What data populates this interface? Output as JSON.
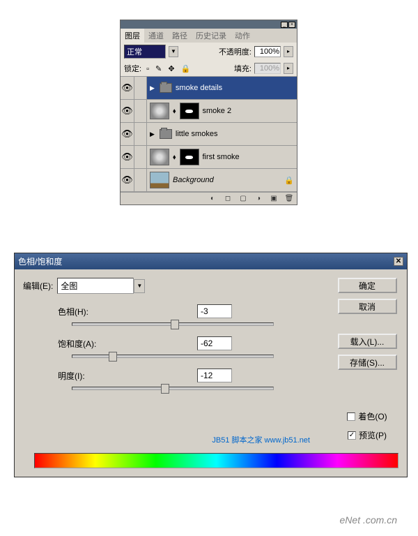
{
  "layers_panel": {
    "tabs": [
      "图层",
      "通道",
      "路径",
      "历史记录",
      "动作"
    ],
    "active_tab": 0,
    "blend_mode": "正常",
    "opacity_label": "不透明度:",
    "opacity_value": "100%",
    "lock_label": "锁定:",
    "fill_label": "填充:",
    "fill_value": "100%",
    "layers": [
      {
        "name": "smoke details",
        "type": "folder",
        "visible": true,
        "selected": true
      },
      {
        "name": "smoke 2",
        "type": "layer_mask",
        "visible": true
      },
      {
        "name": "little smokes",
        "type": "folder",
        "visible": true
      },
      {
        "name": "first smoke",
        "type": "layer_mask",
        "visible": true
      },
      {
        "name": "Background",
        "type": "background",
        "visible": true
      }
    ]
  },
  "dialog": {
    "title": "色相/饱和度",
    "edit_label": "编辑(E):",
    "edit_value": "全图",
    "sliders": {
      "hue": {
        "label": "色相(H):",
        "value": "-3",
        "pos": 49
      },
      "saturation": {
        "label": "饱和度(A):",
        "value": "-62",
        "pos": 18
      },
      "lightness": {
        "label": "明度(I):",
        "value": "-12",
        "pos": 44
      }
    },
    "buttons": {
      "ok": "确定",
      "cancel": "取消",
      "load": "载入(L)...",
      "save": "存储(S)..."
    },
    "colorize": {
      "label": "着色(O)",
      "checked": false
    },
    "preview": {
      "label": "预览(P)",
      "checked": true
    }
  },
  "watermarks": {
    "jb51": "JB51 脚本之家 www.jb51.net",
    "enet": "eNet .com.cn"
  }
}
